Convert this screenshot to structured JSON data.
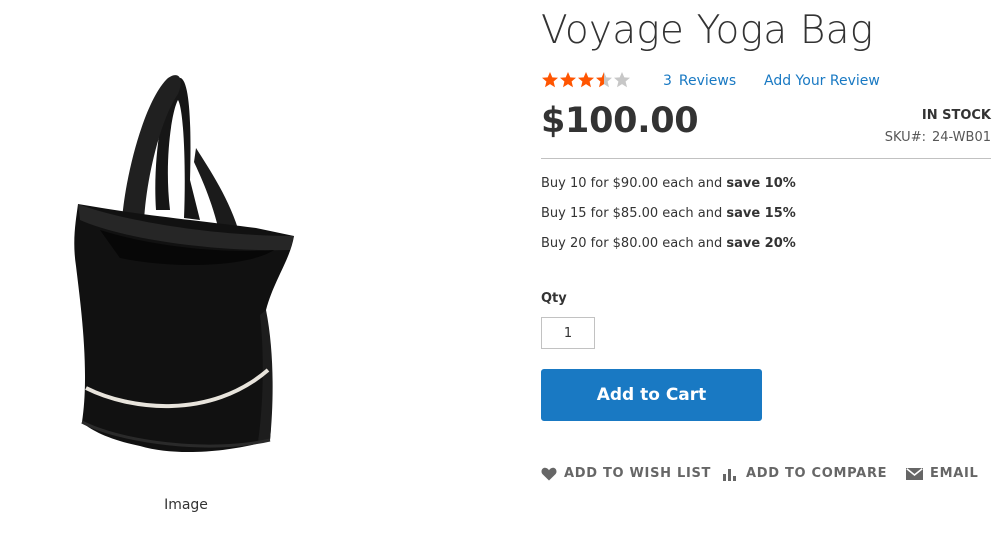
{
  "gallery": {
    "image_icon": "black-tote-bag-image",
    "caption": "Image"
  },
  "product": {
    "title": "Voyage Yoga Bag",
    "rating": {
      "stars_filled": 3.5,
      "stars_total": 5,
      "star_color": "#ff5501",
      "empty_color": "#c7c7c7"
    },
    "reviews_count": "3",
    "reviews_label": "Reviews",
    "add_review_label": "Add Your Review",
    "price": "$100.00",
    "stock_status": "IN STOCK",
    "sku_label": "SKU#:",
    "sku_value": "24-WB01",
    "tier_prices": [
      {
        "text": "Buy 10 for $90.00 each and ",
        "save": "save 10%"
      },
      {
        "text": "Buy 15 for $85.00 each and ",
        "save": "save 15%"
      },
      {
        "text": "Buy 20 for $80.00 each and ",
        "save": "save 20%"
      }
    ],
    "qty_label": "Qty",
    "qty_value": "1",
    "add_to_cart_label": "Add to Cart",
    "accent_color": "#1979c3"
  },
  "actions": {
    "wishlist": {
      "label": "Add to Wish List",
      "icon": "heart-icon"
    },
    "compare": {
      "label": "Add to Compare",
      "icon": "bar-chart-icon"
    },
    "email": {
      "label": "Email",
      "icon": "envelope-icon"
    }
  }
}
